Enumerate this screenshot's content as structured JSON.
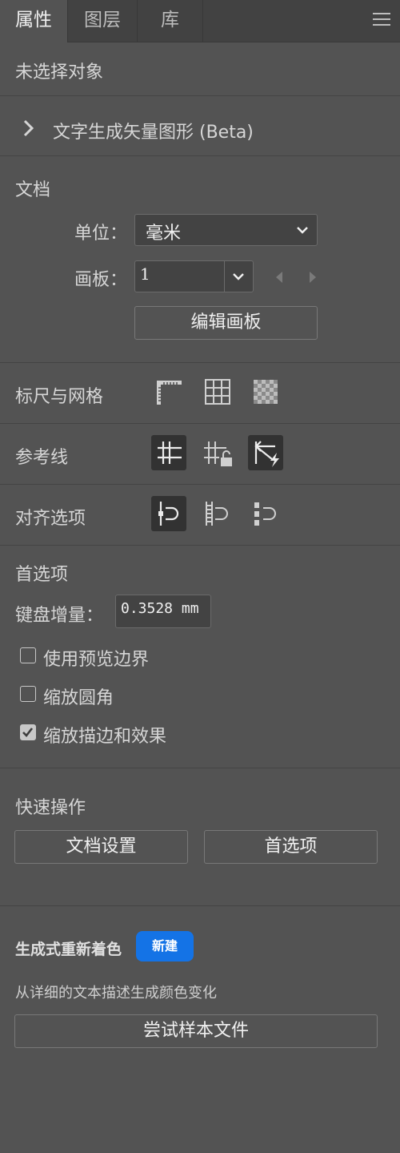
{
  "tabs": [
    {
      "label": "属性",
      "active": true
    },
    {
      "label": "图层",
      "active": false
    },
    {
      "label": "库",
      "active": false
    }
  ],
  "no_selection": "未选择对象",
  "text_to_vector": {
    "label": "文字生成矢量图形 (Beta)",
    "icon": "chevron-right-icon"
  },
  "document": {
    "title": "文档",
    "units_label": "单位：",
    "units_value": "毫米",
    "artboard_label": "画板：",
    "artboard_value": "1",
    "edit_artboards": "编辑画板"
  },
  "rulers_grids": {
    "title": "标尺与网格",
    "icons": [
      "ruler-icon",
      "grid-icon",
      "transparency-grid-icon"
    ]
  },
  "guides": {
    "title": "参考线",
    "icons": [
      "guides-icon",
      "lock-guides-icon",
      "smart-guides-icon"
    ]
  },
  "align": {
    "title": "对齐选项",
    "icons": [
      "snap-to-point-icon",
      "snap-to-pixel-icon",
      "snap-to-glyph-icon"
    ]
  },
  "preferences": {
    "title": "首选项",
    "keyboard_increment_label": "键盘增量：",
    "keyboard_increment_value": "0.3528 mm",
    "options": [
      {
        "label": "使用预览边界",
        "checked": false
      },
      {
        "label": "缩放圆角",
        "checked": false
      },
      {
        "label": "缩放描边和效果",
        "checked": true
      }
    ]
  },
  "quick_actions": {
    "title": "快速操作",
    "document_setup": "文档设置",
    "preferences": "首选项"
  },
  "generative_recolor": {
    "title": "生成式重新着色",
    "badge": "新建",
    "description": "从详细的文本描述生成颜色变化",
    "try_button": "尝试样本文件"
  },
  "colors": {
    "panel": "#535353",
    "tabbar": "#424242",
    "accent": "#1473e6"
  }
}
